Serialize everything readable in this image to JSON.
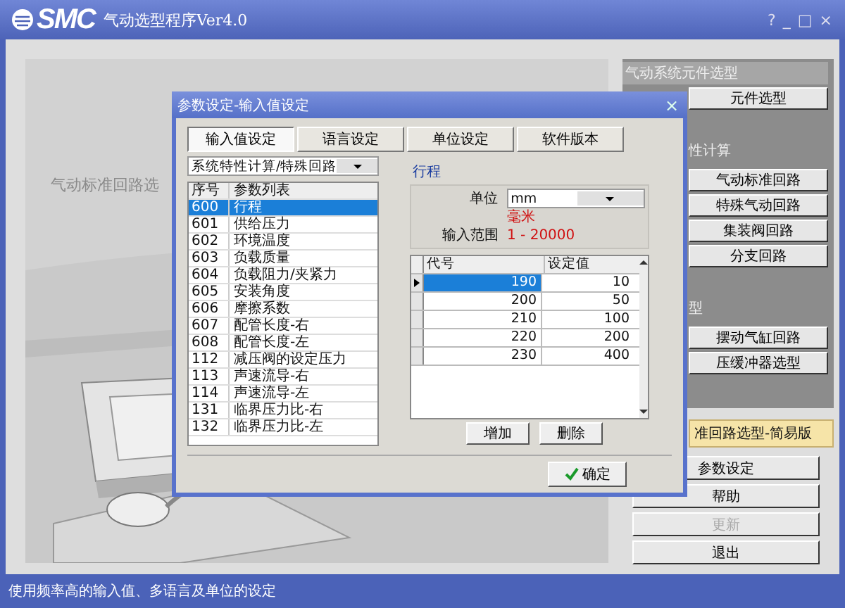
{
  "window": {
    "logo": "SMC",
    "title": "气动选型程序Ver4.0",
    "controls": [
      "?",
      "_",
      "□",
      "×"
    ]
  },
  "background": {
    "caption": "气动标准回路选"
  },
  "side_panel": {
    "header": "气动系统元件选型",
    "groups": [
      {
        "buttons": [
          "元件选型"
        ]
      },
      {
        "heading": "性计算",
        "buttons": [
          "气动标准回路",
          "特殊气动回路",
          "集装阀回路",
          "分支回路"
        ]
      },
      {
        "heading": "型",
        "buttons": [
          "摆动气缸回路",
          "压缓冲器选型"
        ]
      }
    ]
  },
  "mode_label": "准回路选型-简易版",
  "actions": [
    {
      "label": "参数设定",
      "disabled": false
    },
    {
      "label": "帮助",
      "disabled": false
    },
    {
      "label": "更新",
      "disabled": true
    },
    {
      "label": "退出",
      "disabled": false
    }
  ],
  "status_bar": "使用频率高的输入值、多语言及单位的设定",
  "dialog": {
    "title": "参数设定-输入值设定",
    "close": "×",
    "tabs": [
      {
        "label": "输入值设定",
        "selected": true
      },
      {
        "label": "语言设定",
        "selected": false
      },
      {
        "label": "单位设定",
        "selected": false
      },
      {
        "label": "软件版本",
        "selected": false
      }
    ],
    "category": "系统特性计算/特殊回路",
    "params": {
      "columns": [
        "序号",
        "参数列表"
      ],
      "rows": [
        {
          "cells": [
            "600",
            "行程"
          ],
          "selected": true
        },
        {
          "cells": [
            "601",
            "供给压力"
          ],
          "selected": false
        },
        {
          "cells": [
            "602",
            "环境温度"
          ],
          "selected": false
        },
        {
          "cells": [
            "603",
            "负载质量"
          ],
          "selected": false
        },
        {
          "cells": [
            "604",
            "负载阻力/夹紧力"
          ],
          "selected": false
        },
        {
          "cells": [
            "605",
            "安装角度"
          ],
          "selected": false
        },
        {
          "cells": [
            "606",
            "摩擦系数"
          ],
          "selected": false
        },
        {
          "cells": [
            "607",
            "配管长度-右"
          ],
          "selected": false
        },
        {
          "cells": [
            "608",
            "配管长度-左"
          ],
          "selected": false
        },
        {
          "cells": [
            "112",
            "减压阀的设定压力"
          ],
          "selected": false
        },
        {
          "cells": [
            "113",
            "声速流导-右"
          ],
          "selected": false
        },
        {
          "cells": [
            "114",
            "声速流导-左"
          ],
          "selected": false
        },
        {
          "cells": [
            "131",
            "临界压力比-右"
          ],
          "selected": false
        },
        {
          "cells": [
            "132",
            "临界压力比-左"
          ],
          "selected": false
        }
      ]
    },
    "detail": {
      "title": "行程",
      "unit_label": "单位",
      "unit_value": "mm",
      "unit_name": "毫米",
      "range_label": "输入范围",
      "range": "1 - 20000"
    },
    "values": {
      "columns": [
        "代号",
        "设定值"
      ],
      "rows": [
        {
          "cells": [
            "190",
            "10"
          ],
          "selected": true
        },
        {
          "cells": [
            "200",
            "50"
          ],
          "selected": false
        },
        {
          "cells": [
            "210",
            "100"
          ],
          "selected": false
        },
        {
          "cells": [
            "220",
            "200"
          ],
          "selected": false
        },
        {
          "cells": [
            "230",
            "400"
          ],
          "selected": false
        }
      ]
    },
    "buttons": [
      "增加",
      "删除"
    ],
    "ok": "确定"
  }
}
